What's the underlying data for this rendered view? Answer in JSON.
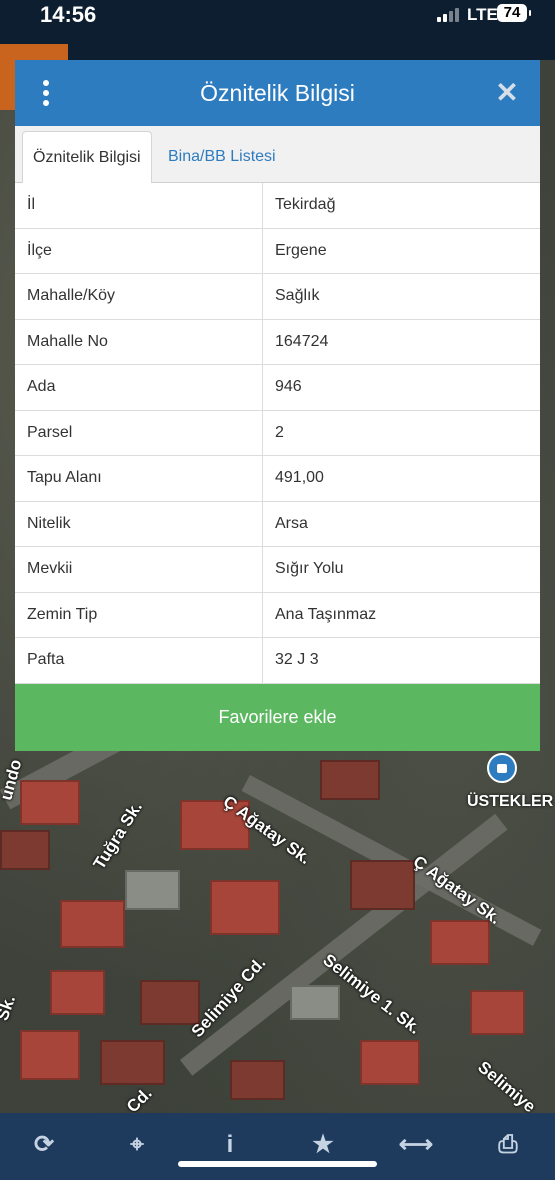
{
  "status_bar": {
    "time": "14:56",
    "network": "LTE",
    "battery": "74"
  },
  "dialog": {
    "title": "Öznitelik Bilgisi",
    "close_icon": "close-icon",
    "menu_icon": "more-vert-icon",
    "tabs": [
      {
        "label": "Öznitelik Bilgisi",
        "active": true
      },
      {
        "label": "Bina/BB Listesi",
        "active": false
      }
    ],
    "rows": [
      {
        "key": "İl",
        "value": "Tekirdağ"
      },
      {
        "key": "İlçe",
        "value": "Ergene"
      },
      {
        "key": "Mahalle/Köy",
        "value": "Sağlık"
      },
      {
        "key": "Mahalle No",
        "value": "164724"
      },
      {
        "key": "Ada",
        "value": "946"
      },
      {
        "key": "Parsel",
        "value": "2"
      },
      {
        "key": "Tapu Alanı",
        "value": "491,00"
      },
      {
        "key": "Nitelik",
        "value": "Arsa"
      },
      {
        "key": "Mevkii",
        "value": "Sığır Yolu"
      },
      {
        "key": "Zemin Tip",
        "value": "Ana Taşınmaz"
      },
      {
        "key": "Pafta",
        "value": "32 J 3"
      }
    ],
    "favorite_button": "Favorilere ekle"
  },
  "map": {
    "streets": [
      "Tuğra Sk.",
      "Ç Ağatay Sk.",
      "Ç Ağatay Sk.",
      "Selimiye Cd.",
      "Selimiye 1. Sk.",
      "Selimiye",
      "Sk.",
      "Cd.",
      "undo"
    ],
    "marker_label": "ÜSTEKLER"
  },
  "toolbar": {
    "buttons": [
      {
        "name": "refresh-icon",
        "glyph": "⟳"
      },
      {
        "name": "locate-icon",
        "glyph": "⌖"
      },
      {
        "name": "info-icon",
        "glyph": "i"
      },
      {
        "name": "favorites-icon",
        "glyph": "★"
      },
      {
        "name": "measure-icon",
        "glyph": "⟷"
      },
      {
        "name": "print-icon",
        "glyph": "⎙"
      }
    ]
  },
  "colors": {
    "header": "#2e7cc0",
    "favorite_button": "#5cb860",
    "status_bar": "#0d1e30",
    "toolbar": "#1e3a5c"
  }
}
